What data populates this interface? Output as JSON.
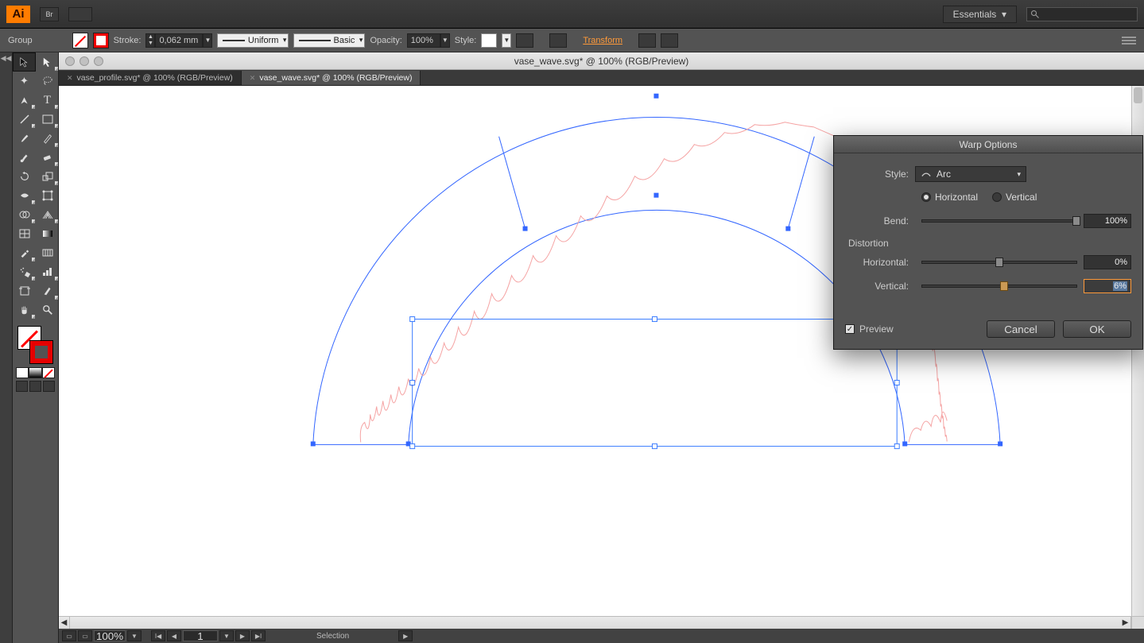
{
  "menubar": {
    "workspace": "Essentials"
  },
  "controlbar": {
    "group_label": "Group",
    "stroke_label": "Stroke:",
    "stroke_value": "0,062 mm",
    "stroke_profile": "Uniform",
    "brush": "Basic",
    "opacity_label": "Opacity:",
    "opacity": "100%",
    "style_label": "Style:",
    "transform": "Transform"
  },
  "window": {
    "title": "vase_wave.svg* @ 100% (RGB/Preview)"
  },
  "tabs": [
    {
      "label": "vase_profile.svg* @ 100% (RGB/Preview)",
      "active": false
    },
    {
      "label": "vase_wave.svg* @ 100% (RGB/Preview)",
      "active": true
    }
  ],
  "statusbar": {
    "zoom": "100%",
    "page": "1",
    "tool": "Selection"
  },
  "dialog": {
    "title": "Warp Options",
    "style_label": "Style:",
    "style_value": "Arc",
    "orient_h": "Horizontal",
    "orient_v": "Vertical",
    "bend_label": "Bend:",
    "bend_value": "100%",
    "distortion_label": "Distortion",
    "hdist_label": "Horizontal:",
    "hdist_value": "0%",
    "vdist_label": "Vertical:",
    "vdist_value": "6%",
    "preview": "Preview",
    "cancel": "Cancel",
    "ok": "OK"
  },
  "tooltips": {
    "selection": "Selection Tool",
    "direct": "Direct Selection Tool",
    "wand": "Magic Wand",
    "lasso": "Lasso",
    "pen": "Pen Tool",
    "type": "Type Tool",
    "line": "Line Segment",
    "rect": "Rectangle",
    "brush": "Paintbrush",
    "pencil": "Pencil",
    "blob": "Blob Brush",
    "eraser": "Eraser",
    "rotate": "Rotate",
    "scale": "Scale",
    "width": "Width Tool",
    "free": "Free Transform",
    "shaper": "Shape Builder",
    "perspective": "Perspective Grid",
    "mesh": "Mesh",
    "gradient": "Gradient",
    "eyedrop": "Eyedropper",
    "blend": "Blend",
    "symbol": "Symbol Sprayer",
    "graph": "Column Graph",
    "artboard": "Artboard",
    "slice": "Slice",
    "hand": "Hand",
    "zoom": "Zoom"
  }
}
